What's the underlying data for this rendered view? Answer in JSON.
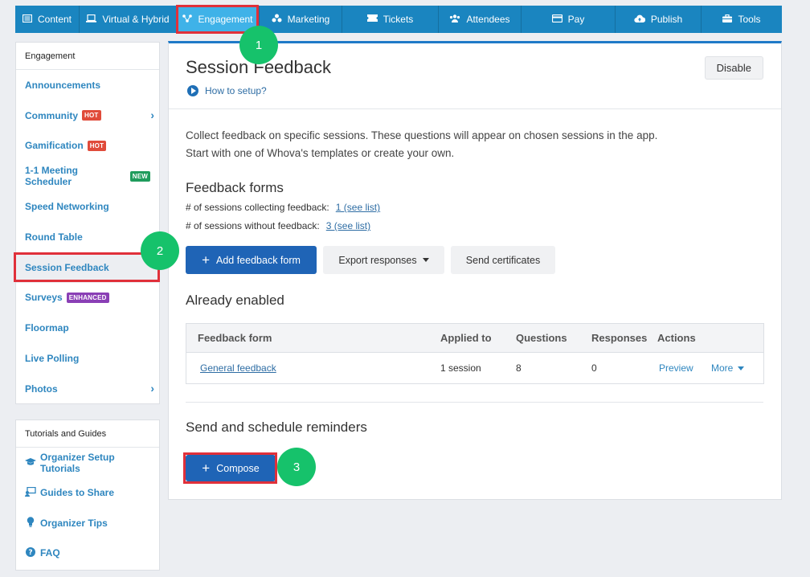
{
  "topnav": {
    "items": [
      {
        "label": "Content",
        "icon": "content-icon"
      },
      {
        "label": "Virtual & Hybrid",
        "icon": "laptop-icon"
      },
      {
        "label": "Engagement",
        "icon": "engagement-icon",
        "active": true
      },
      {
        "label": "Marketing",
        "icon": "marketing-icon"
      },
      {
        "label": "Tickets",
        "icon": "ticket-icon"
      },
      {
        "label": "Attendees",
        "icon": "attendees-icon"
      },
      {
        "label": "Pay",
        "icon": "card-icon"
      },
      {
        "label": "Publish",
        "icon": "cloud-upload-icon"
      },
      {
        "label": "Tools",
        "icon": "toolbox-icon"
      }
    ]
  },
  "sidebar": {
    "header": "Engagement",
    "items": [
      {
        "label": "Announcements"
      },
      {
        "label": "Community",
        "badge": "HOT"
      },
      {
        "label": "Gamification",
        "badge": "HOT"
      },
      {
        "label": "1-1 Meeting Scheduler",
        "badge": "NEW"
      },
      {
        "label": "Speed Networking"
      },
      {
        "label": "Round Table"
      },
      {
        "label": "Session Feedback"
      },
      {
        "label": "Surveys",
        "badge": "ENHANCED"
      },
      {
        "label": "Floormap"
      },
      {
        "label": "Live Polling"
      },
      {
        "label": "Photos"
      }
    ]
  },
  "tutorials": {
    "header": "Tutorials and Guides",
    "items": [
      {
        "label": "Organizer Setup Tutorials",
        "icon": "graduation-cap-icon"
      },
      {
        "label": "Guides to Share",
        "icon": "share-guides-icon"
      },
      {
        "label": "Organizer Tips",
        "icon": "lightbulb-icon"
      },
      {
        "label": "FAQ",
        "icon": "question-icon"
      }
    ]
  },
  "main": {
    "title": "Session Feedback",
    "how_to": "How to setup?",
    "disable_label": "Disable",
    "description": "Collect feedback on specific sessions. These questions will appear on chosen sessions in the app. Start with one of Whova's templates or create your own.",
    "feedback_forms_heading": "Feedback forms",
    "stat1_label": "# of sessions collecting feedback:",
    "stat1_link": "1 (see list)",
    "stat2_label": "# of sessions without feedback:",
    "stat2_link": "3 (see list)",
    "add_form_label": "Add feedback form",
    "export_label": "Export responses",
    "certificates_label": "Send certificates",
    "already_enabled_heading": "Already enabled",
    "table": {
      "headers": [
        "Feedback form",
        "Applied to",
        "Questions",
        "Responses",
        "Actions"
      ],
      "rows": [
        {
          "form": "General feedback",
          "applied_to": "1 session",
          "questions": "8",
          "responses": "0",
          "preview": "Preview",
          "more": "More"
        }
      ]
    },
    "reminders_heading": "Send and schedule reminders",
    "compose_label": "Compose"
  },
  "steps": [
    "1",
    "2",
    "3"
  ],
  "colors": {
    "nav_bg": "#1a85c0",
    "nav_active": "#3fb2e8",
    "primary_button": "#1f64b6",
    "highlight_red": "#e0303a",
    "step_green": "#16c26b",
    "link_blue": "#2e86bf"
  }
}
